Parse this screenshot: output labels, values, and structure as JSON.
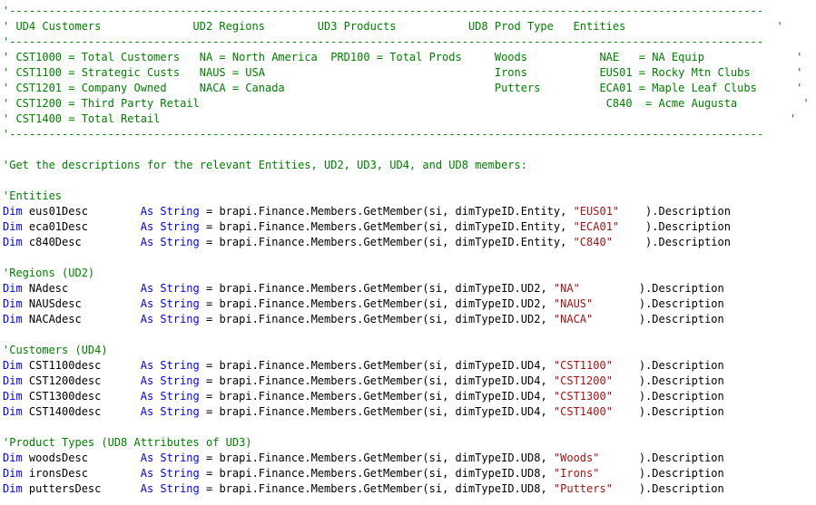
{
  "editor": {
    "language": "vb",
    "colors": {
      "comment": "#008000",
      "keyword": "#0000ff",
      "string": "#a31515",
      "text": "#000000",
      "background": "#ffffff"
    },
    "lines": [
      [
        [
          "c",
          "'-------------------------------------------------------------------------------------------------------------------"
        ]
      ],
      [
        [
          "c",
          "' UD4 Customers              UD2 Regions        UD3 Products           UD8 Prod Type   Entities                       '"
        ]
      ],
      [
        [
          "c",
          "'-------------------------------------------------------------------------------------------------------------------"
        ]
      ],
      [
        [
          "c",
          "' CST1000 = Total Customers   NA = North America  PRD100 = Total Prods     Woods           NAE   = NA Equip              '"
        ]
      ],
      [
        [
          "c",
          "' CST1100 = Strategic Custs   NAUS = USA                                   Irons           EUS01 = Rocky Mtn Clubs       '"
        ]
      ],
      [
        [
          "c",
          "' CST1201 = Company Owned     NACA = Canada                                Putters         ECA01 = Maple Leaf Clubs      '"
        ]
      ],
      [
        [
          "c",
          "' CST1200 = Third Party Retail                                                              C840  = Acme Augusta          '"
        ]
      ],
      [
        [
          "c",
          "' CST1400 = Total Retail                                                                                                '"
        ]
      ],
      [
        [
          "c",
          "'-------------------------------------------------------------------------------------------------------------------"
        ]
      ],
      [],
      [
        [
          "c",
          "'Get the descriptions for the relevant Entities, UD2, UD3, UD4, and UD8 members:"
        ]
      ],
      [],
      [
        [
          "c",
          "'Entities"
        ]
      ],
      [
        [
          "k",
          "Dim"
        ],
        [
          "t",
          " eus01Desc        "
        ],
        [
          "k",
          "As String"
        ],
        [
          "t",
          " = brapi.Finance.Members.GetMember(si, dimTypeID.Entity, "
        ],
        [
          "s",
          "\"EUS01\""
        ],
        [
          "t",
          "    ).Description"
        ]
      ],
      [
        [
          "k",
          "Dim"
        ],
        [
          "t",
          " eca01Desc        "
        ],
        [
          "k",
          "As String"
        ],
        [
          "t",
          " = brapi.Finance.Members.GetMember(si, dimTypeID.Entity, "
        ],
        [
          "s",
          "\"ECA01\""
        ],
        [
          "t",
          "    ).Description"
        ]
      ],
      [
        [
          "k",
          "Dim"
        ],
        [
          "t",
          " c840Desc         "
        ],
        [
          "k",
          "As String"
        ],
        [
          "t",
          " = brapi.Finance.Members.GetMember(si, dimTypeID.Entity, "
        ],
        [
          "s",
          "\"C840\""
        ],
        [
          "t",
          "     ).Description"
        ]
      ],
      [],
      [
        [
          "c",
          "'Regions (UD2)"
        ]
      ],
      [
        [
          "k",
          "Dim"
        ],
        [
          "t",
          " NAdesc           "
        ],
        [
          "k",
          "As String"
        ],
        [
          "t",
          " = brapi.Finance.Members.GetMember(si, dimTypeID.UD2, "
        ],
        [
          "s",
          "\"NA\""
        ],
        [
          "t",
          "         ).Description"
        ]
      ],
      [
        [
          "k",
          "Dim"
        ],
        [
          "t",
          " NAUSdesc         "
        ],
        [
          "k",
          "As String"
        ],
        [
          "t",
          " = brapi.Finance.Members.GetMember(si, dimTypeID.UD2, "
        ],
        [
          "s",
          "\"NAUS\""
        ],
        [
          "t",
          "       ).Description"
        ]
      ],
      [
        [
          "k",
          "Dim"
        ],
        [
          "t",
          " NACAdesc         "
        ],
        [
          "k",
          "As String"
        ],
        [
          "t",
          " = brapi.Finance.Members.GetMember(si, dimTypeID.UD2, "
        ],
        [
          "s",
          "\"NACA\""
        ],
        [
          "t",
          "       ).Description"
        ]
      ],
      [],
      [
        [
          "c",
          "'Customers (UD4)"
        ]
      ],
      [
        [
          "k",
          "Dim"
        ],
        [
          "t",
          " CST1100desc      "
        ],
        [
          "k",
          "As String"
        ],
        [
          "t",
          " = brapi.Finance.Members.GetMember(si, dimTypeID.UD4, "
        ],
        [
          "s",
          "\"CST1100\""
        ],
        [
          "t",
          "    ).Description"
        ]
      ],
      [
        [
          "k",
          "Dim"
        ],
        [
          "t",
          " CST1200desc      "
        ],
        [
          "k",
          "As String"
        ],
        [
          "t",
          " = brapi.Finance.Members.GetMember(si, dimTypeID.UD4, "
        ],
        [
          "s",
          "\"CST1200\""
        ],
        [
          "t",
          "    ).Description"
        ]
      ],
      [
        [
          "k",
          "Dim"
        ],
        [
          "t",
          " CST1300desc      "
        ],
        [
          "k",
          "As String"
        ],
        [
          "t",
          " = brapi.Finance.Members.GetMember(si, dimTypeID.UD4, "
        ],
        [
          "s",
          "\"CST1300\""
        ],
        [
          "t",
          "    ).Description"
        ]
      ],
      [
        [
          "k",
          "Dim"
        ],
        [
          "t",
          " CST1400desc      "
        ],
        [
          "k",
          "As String"
        ],
        [
          "t",
          " = brapi.Finance.Members.GetMember(si, dimTypeID.UD4, "
        ],
        [
          "s",
          "\"CST1400\""
        ],
        [
          "t",
          "    ).Description"
        ]
      ],
      [],
      [
        [
          "c",
          "'Product Types (UD8 Attributes of UD3)"
        ]
      ],
      [
        [
          "k",
          "Dim"
        ],
        [
          "t",
          " woodsDesc        "
        ],
        [
          "k",
          "As String"
        ],
        [
          "t",
          " = brapi.Finance.Members.GetMember(si, dimTypeID.UD8, "
        ],
        [
          "s",
          "\"Woods\""
        ],
        [
          "t",
          "      ).Description"
        ]
      ],
      [
        [
          "k",
          "Dim"
        ],
        [
          "t",
          " ironsDesc        "
        ],
        [
          "k",
          "As String"
        ],
        [
          "t",
          " = brapi.Finance.Members.GetMember(si, dimTypeID.UD8, "
        ],
        [
          "s",
          "\"Irons\""
        ],
        [
          "t",
          "      ).Description"
        ]
      ],
      [
        [
          "k",
          "Dim"
        ],
        [
          "t",
          " puttersDesc      "
        ],
        [
          "k",
          "As String"
        ],
        [
          "t",
          " = brapi.Finance.Members.GetMember(si, dimTypeID.UD8, "
        ],
        [
          "s",
          "\"Putters\""
        ],
        [
          "t",
          "    ).Description"
        ]
      ]
    ]
  }
}
